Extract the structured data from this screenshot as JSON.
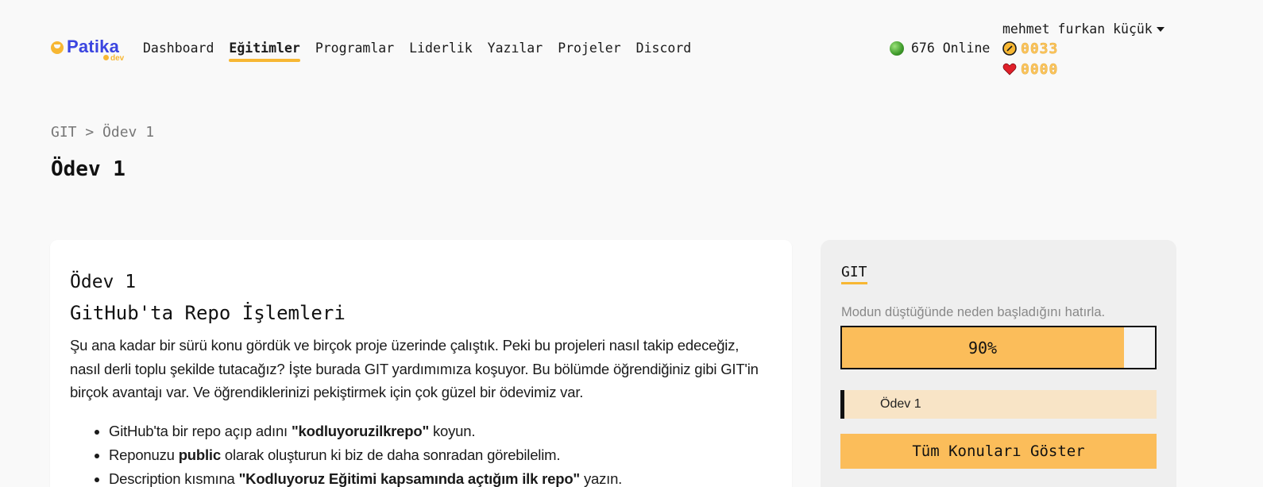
{
  "brand": {
    "name": "Patika",
    "sub": "dev"
  },
  "nav": {
    "items": [
      "Dashboard",
      "Eğitimler",
      "Programlar",
      "Liderlik",
      "Yazılar",
      "Projeler",
      "Discord"
    ],
    "active": "Eğitimler"
  },
  "header": {
    "online": "676 Online",
    "user_name": "mehmet furkan küçük",
    "coins": "0033",
    "hearts": "0000",
    "icons": {
      "online": "green-dot-icon",
      "coins": "coin-icon",
      "hearts": "heart-icon",
      "menu": "caret-down-icon"
    }
  },
  "breadcrumb": "GIT > Ödev 1",
  "page_title": "Ödev 1",
  "content": {
    "heading": "Ödev 1",
    "subheading": "GitHub'ta Repo İşlemleri",
    "paragraph": "Şu ana kadar bir sürü konu gördük ve birçok proje üzerinde çalıştık. Peki bu projeleri nasıl takip edeceğiz, nasıl derli toplu şekilde tutacağız? İşte burada GIT yardımımıza koşuyor. Bu bölümde öğrendiğiniz gibi GIT'in birçok avantajı var. Ve öğrendiklerinizi pekiştirmek için çok güzel bir ödevimiz var.",
    "list": [
      {
        "before": "GitHub'ta bir repo açıp adını ",
        "bold": "\"kodluyoruzilkrepo\"",
        "after": " koyun."
      },
      {
        "before": "Reponuzu ",
        "bold": "public",
        "after": " olarak oluşturun ki biz de daha sonradan görebilelim."
      },
      {
        "before": "Description kısmına ",
        "bold": "\"Kodluyoruz Eğitimi kapsamında açtığım ilk repo\"",
        "after": " yazın."
      }
    ]
  },
  "sidebar": {
    "title": "GIT",
    "motto": "Modun düştüğünde neden başladığını hatırla.",
    "progress_value": 0.9,
    "progress_label": "90%",
    "lesson": "Ödev 1",
    "show_all": "Tüm Konuları Göster"
  },
  "colors": {
    "accent": "#fbbd5a",
    "brand": "#3b45e0",
    "lesson_bg": "#f8e4c6"
  }
}
